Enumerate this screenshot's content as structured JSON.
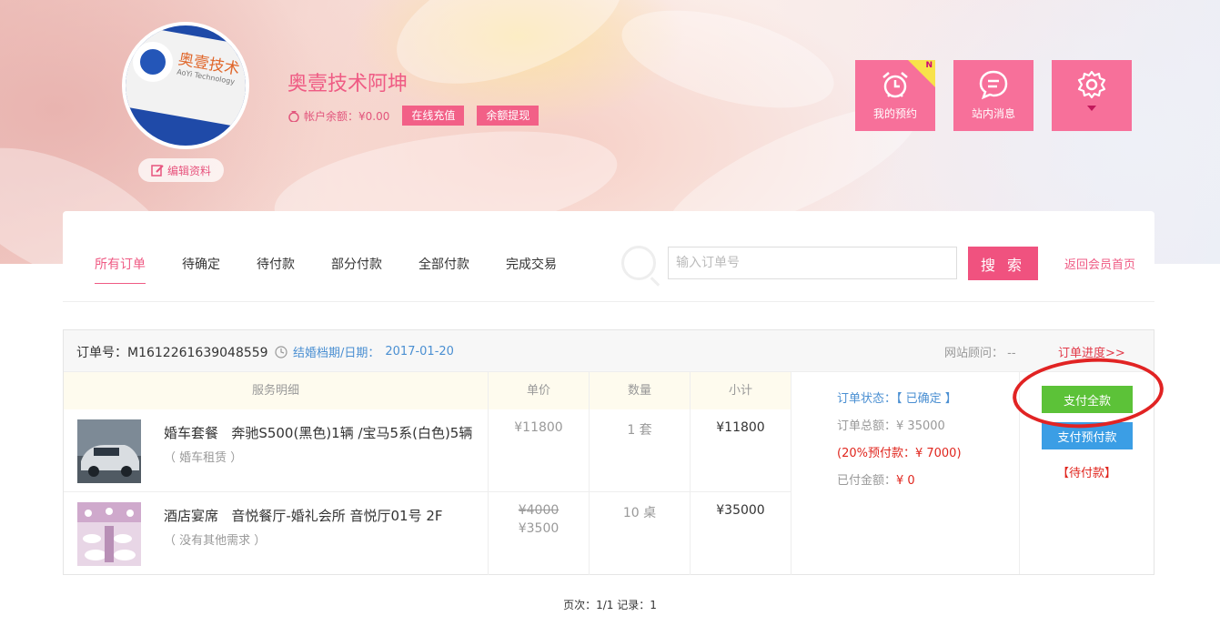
{
  "profile": {
    "logo_text": "奥壹技术",
    "logo_subtext": "AoYi Technology",
    "username": "奥壹技术阿坤",
    "balance_label": "帐户余额：¥0.00",
    "recharge_label": "在线充值",
    "withdraw_label": "余额提现",
    "edit_label": "编辑资料"
  },
  "quick_tiles": [
    {
      "label": "我的预约",
      "icon": "alarm-clock-icon",
      "badge": "N"
    },
    {
      "label": "站内消息",
      "icon": "chat-bubble-icon"
    },
    {
      "label": "",
      "icon": "gear-icon"
    }
  ],
  "tabs": [
    "所有订单",
    "待确定",
    "待付款",
    "部分付款",
    "全部付款",
    "完成交易"
  ],
  "active_tab": 0,
  "search": {
    "placeholder": "输入订单号",
    "value": "",
    "button_label": "搜 索"
  },
  "back_link": "返回会员首页",
  "order": {
    "number_label": "订单号：M1612261639048559",
    "date_label": "结婚档期/日期：",
    "date": "2017-01-20",
    "advisor": "网站顾问： --",
    "progress_link": "订单进度>>",
    "columns": [
      "服务明细",
      "单价",
      "数量",
      "小计"
    ],
    "items": [
      {
        "category": "婚车套餐",
        "detail": "奔驰S500(黑色)1辆 /宝马5系(白色)5辆",
        "note": "（ 婚车租赁 ）",
        "price": "¥11800",
        "old_price": "",
        "qty": "1 套",
        "subtotal": "¥11800",
        "thumb": "car-photo"
      },
      {
        "category": "酒店宴席",
        "detail": "音悦餐厅-婚礼会所 音悦厅01号 2F",
        "note": "（ 没有其他需求 ）",
        "old_price": "¥4000",
        "price": "¥3500",
        "qty": "10 桌",
        "subtotal": "¥35000",
        "thumb": "banquet-hall-photo"
      }
    ],
    "status_label": "订单状态：",
    "status_value": "【 已确定 】",
    "total_label": "订单总额：",
    "total_value": "¥ 35000",
    "deposit_label": "(20%预付款：¥ 7000)",
    "paid_label": "已付金额：",
    "paid_value": "¥ 0",
    "pay_full_label": "支付全款",
    "pay_deposit_label": "支付预付款",
    "pending_label": "【待付款】"
  },
  "pager": "页次：1/1  记录：1",
  "colors": {
    "accent": "#ef5b84",
    "tile": "#f7709a",
    "green": "#5cc238",
    "blue": "#3b9ee5",
    "red": "#e0261e"
  }
}
